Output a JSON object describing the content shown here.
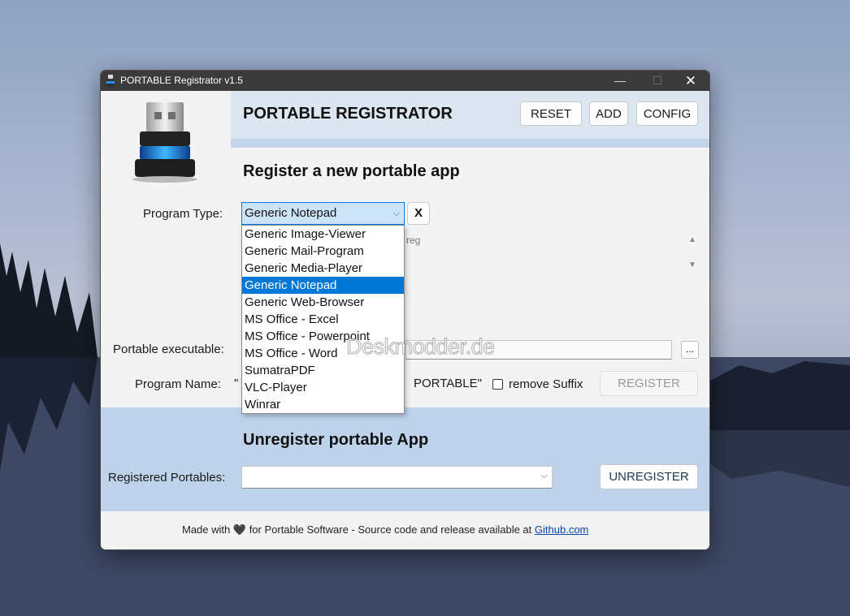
{
  "window": {
    "title": "PORTABLE Registrator v1.5",
    "minimize_glyph": "—",
    "maximize_glyph": "☐",
    "close_glyph": "✕"
  },
  "header": {
    "title": "PORTABLE REGISTRATOR",
    "reset_label": "RESET",
    "add_label": "ADD",
    "config_label": "CONFIG"
  },
  "register": {
    "section_title": "Register a new portable app",
    "program_type_label": "Program Type:",
    "program_type_value": "Generic Notepad",
    "clear_label": "X",
    "reg_hint": "reg",
    "executable_label": "Portable executable:",
    "browse_label": "...",
    "program_name_label": "Program Name:",
    "quote_left": "\"",
    "portable_suffix": "PORTABLE\"",
    "remove_suffix_label": "remove Suffix",
    "remove_suffix_checked": false,
    "register_label": "REGISTER"
  },
  "dropdown": {
    "options": [
      "Generic Image-Viewer",
      "Generic Mail-Program",
      "Generic Media-Player",
      "Generic Notepad",
      "Generic Web-Browser",
      "MS Office - Excel",
      "MS Office - Powerpoint",
      "MS Office - Word",
      "SumatraPDF",
      "VLC-Player",
      "Winrar"
    ],
    "selected": "Generic Notepad"
  },
  "unregister": {
    "section_title": "Unregister portable App",
    "registered_label": "Registered Portables:",
    "registered_value": "",
    "unregister_label": "UNREGISTER"
  },
  "footer": {
    "made_with": "Made with",
    "heart": "🖤",
    "rest": "for Portable Software - Source code and release available at",
    "link": "Github.com"
  },
  "watermark": "Deskmodder.de",
  "icons": {
    "chevron": "⌵",
    "scroll_up": "▲",
    "scroll_down": "▼"
  },
  "colors": {
    "accent": "#0078d7",
    "header_band": "#dce6f1",
    "unregister_band": "#bed3ea",
    "titlebar": "#3b3b3b"
  }
}
